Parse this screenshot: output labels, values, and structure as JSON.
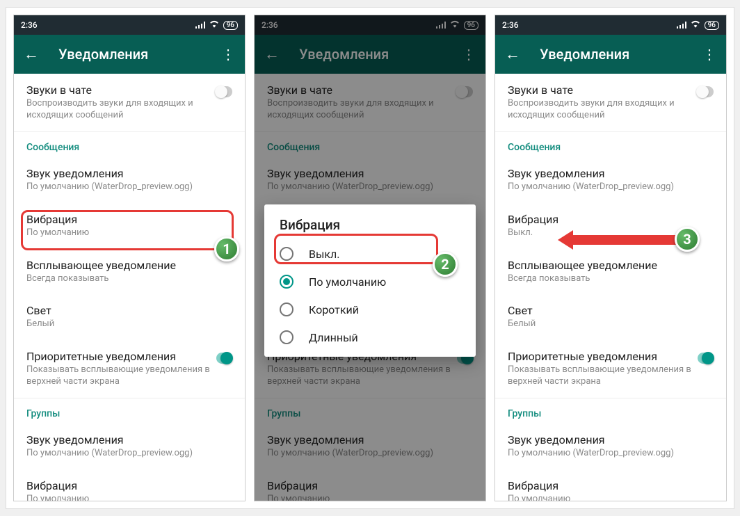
{
  "status": {
    "time": "2:36",
    "battery": "96"
  },
  "appbar": {
    "title": "Уведомления"
  },
  "chatSounds": {
    "title": "Звуки в чате",
    "desc": "Воспроизводить звуки для входящих и исходящих сообщений"
  },
  "sections": {
    "messages": "Сообщения",
    "groups": "Группы"
  },
  "items": {
    "notifSound": {
      "title": "Звук уведомления",
      "value": "По умолчанию (WaterDrop_preview.ogg)"
    },
    "vibration": {
      "title": "Вибрация",
      "valueDefault": "По умолчанию",
      "valueOff": "Выкл."
    },
    "popup": {
      "title": "Всплывающее уведомление",
      "value": "Всегда показывать"
    },
    "light": {
      "title": "Свет",
      "value": "Белый"
    },
    "priority": {
      "title": "Приоритетные уведомления",
      "desc": "Показывать всплывающие уведомления в верхней части экрана"
    },
    "groupVibration": {
      "title": "Вибрация",
      "value": "По умолчанию"
    }
  },
  "dialog": {
    "title": "Вибрация",
    "options": {
      "off": "Выкл.",
      "default": "По умолчанию",
      "short": "Короткий",
      "long": "Длинный"
    }
  },
  "annotations": {
    "step1": "1",
    "step2": "2",
    "step3": "3"
  }
}
